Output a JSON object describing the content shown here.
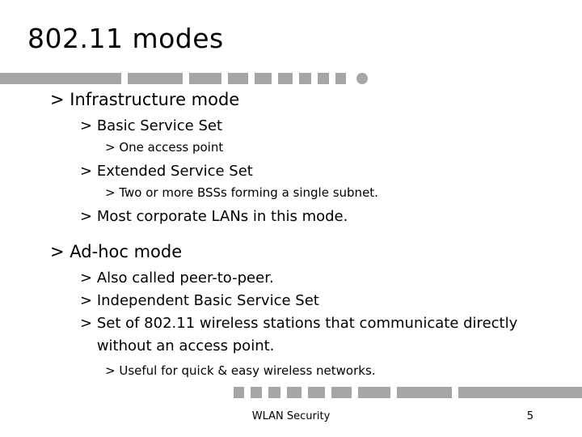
{
  "slide": {
    "title": "802.11 modes",
    "footer": "WLAN Security",
    "page_number": "5",
    "accent_color": "#a6a6a6",
    "background_color": "#ffffff",
    "text_color": "#000000"
  },
  "bullets": [
    {
      "level": 1,
      "marker": ">",
      "text": "Infrastructure mode"
    },
    {
      "level": 2,
      "marker": ">",
      "text": "Basic Service Set"
    },
    {
      "level": 3,
      "marker": ">",
      "text": "One access point"
    },
    {
      "level": 2,
      "marker": ">",
      "text": "Extended Service Set"
    },
    {
      "level": 3,
      "marker": ">",
      "text": "Two or more BSSs forming a single subnet."
    },
    {
      "level": 2,
      "marker": ">",
      "text": "Most corporate LANs in this mode."
    },
    {
      "level": 1,
      "marker": ">",
      "text": "Ad-hoc mode"
    },
    {
      "level": 2,
      "marker": ">",
      "text": "Also called peer-to-peer."
    },
    {
      "level": 2,
      "marker": ">",
      "text": "Independent Basic Service Set"
    },
    {
      "level": 2,
      "marker": ">",
      "text": "Set of 802.11 wireless stations that communicate directly without an access point."
    },
    {
      "level": 3,
      "marker": ">",
      "text": "Useful for quick & easy wireless networks."
    }
  ]
}
